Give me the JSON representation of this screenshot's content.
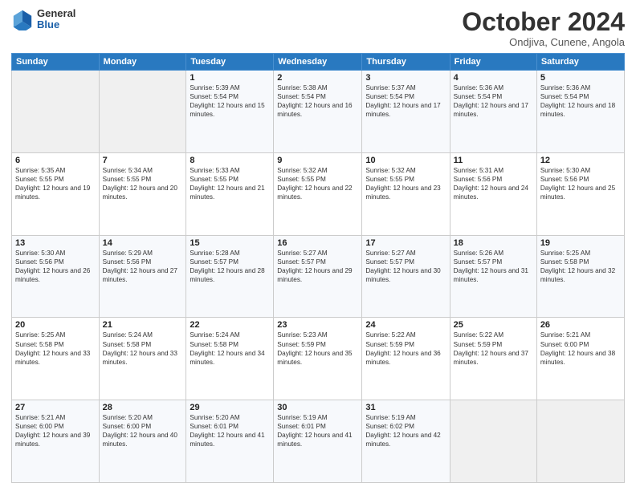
{
  "logo": {
    "general": "General",
    "blue": "Blue"
  },
  "title": "October 2024",
  "subtitle": "Ondjiva, Cunene, Angola",
  "headers": [
    "Sunday",
    "Monday",
    "Tuesday",
    "Wednesday",
    "Thursday",
    "Friday",
    "Saturday"
  ],
  "weeks": [
    [
      {
        "day": "",
        "empty": true
      },
      {
        "day": "",
        "empty": true
      },
      {
        "day": "1",
        "sunrise": "5:39 AM",
        "sunset": "5:54 PM",
        "daylight": "12 hours and 15 minutes."
      },
      {
        "day": "2",
        "sunrise": "5:38 AM",
        "sunset": "5:54 PM",
        "daylight": "12 hours and 16 minutes."
      },
      {
        "day": "3",
        "sunrise": "5:37 AM",
        "sunset": "5:54 PM",
        "daylight": "12 hours and 17 minutes."
      },
      {
        "day": "4",
        "sunrise": "5:36 AM",
        "sunset": "5:54 PM",
        "daylight": "12 hours and 17 minutes."
      },
      {
        "day": "5",
        "sunrise": "5:36 AM",
        "sunset": "5:54 PM",
        "daylight": "12 hours and 18 minutes."
      }
    ],
    [
      {
        "day": "6",
        "sunrise": "5:35 AM",
        "sunset": "5:55 PM",
        "daylight": "12 hours and 19 minutes."
      },
      {
        "day": "7",
        "sunrise": "5:34 AM",
        "sunset": "5:55 PM",
        "daylight": "12 hours and 20 minutes."
      },
      {
        "day": "8",
        "sunrise": "5:33 AM",
        "sunset": "5:55 PM",
        "daylight": "12 hours and 21 minutes."
      },
      {
        "day": "9",
        "sunrise": "5:32 AM",
        "sunset": "5:55 PM",
        "daylight": "12 hours and 22 minutes."
      },
      {
        "day": "10",
        "sunrise": "5:32 AM",
        "sunset": "5:55 PM",
        "daylight": "12 hours and 23 minutes."
      },
      {
        "day": "11",
        "sunrise": "5:31 AM",
        "sunset": "5:56 PM",
        "daylight": "12 hours and 24 minutes."
      },
      {
        "day": "12",
        "sunrise": "5:30 AM",
        "sunset": "5:56 PM",
        "daylight": "12 hours and 25 minutes."
      }
    ],
    [
      {
        "day": "13",
        "sunrise": "5:30 AM",
        "sunset": "5:56 PM",
        "daylight": "12 hours and 26 minutes."
      },
      {
        "day": "14",
        "sunrise": "5:29 AM",
        "sunset": "5:56 PM",
        "daylight": "12 hours and 27 minutes."
      },
      {
        "day": "15",
        "sunrise": "5:28 AM",
        "sunset": "5:57 PM",
        "daylight": "12 hours and 28 minutes."
      },
      {
        "day": "16",
        "sunrise": "5:27 AM",
        "sunset": "5:57 PM",
        "daylight": "12 hours and 29 minutes."
      },
      {
        "day": "17",
        "sunrise": "5:27 AM",
        "sunset": "5:57 PM",
        "daylight": "12 hours and 30 minutes."
      },
      {
        "day": "18",
        "sunrise": "5:26 AM",
        "sunset": "5:57 PM",
        "daylight": "12 hours and 31 minutes."
      },
      {
        "day": "19",
        "sunrise": "5:25 AM",
        "sunset": "5:58 PM",
        "daylight": "12 hours and 32 minutes."
      }
    ],
    [
      {
        "day": "20",
        "sunrise": "5:25 AM",
        "sunset": "5:58 PM",
        "daylight": "12 hours and 33 minutes."
      },
      {
        "day": "21",
        "sunrise": "5:24 AM",
        "sunset": "5:58 PM",
        "daylight": "12 hours and 33 minutes."
      },
      {
        "day": "22",
        "sunrise": "5:24 AM",
        "sunset": "5:58 PM",
        "daylight": "12 hours and 34 minutes."
      },
      {
        "day": "23",
        "sunrise": "5:23 AM",
        "sunset": "5:59 PM",
        "daylight": "12 hours and 35 minutes."
      },
      {
        "day": "24",
        "sunrise": "5:22 AM",
        "sunset": "5:59 PM",
        "daylight": "12 hours and 36 minutes."
      },
      {
        "day": "25",
        "sunrise": "5:22 AM",
        "sunset": "5:59 PM",
        "daylight": "12 hours and 37 minutes."
      },
      {
        "day": "26",
        "sunrise": "5:21 AM",
        "sunset": "6:00 PM",
        "daylight": "12 hours and 38 minutes."
      }
    ],
    [
      {
        "day": "27",
        "sunrise": "5:21 AM",
        "sunset": "6:00 PM",
        "daylight": "12 hours and 39 minutes."
      },
      {
        "day": "28",
        "sunrise": "5:20 AM",
        "sunset": "6:00 PM",
        "daylight": "12 hours and 40 minutes."
      },
      {
        "day": "29",
        "sunrise": "5:20 AM",
        "sunset": "6:01 PM",
        "daylight": "12 hours and 41 minutes."
      },
      {
        "day": "30",
        "sunrise": "5:19 AM",
        "sunset": "6:01 PM",
        "daylight": "12 hours and 41 minutes."
      },
      {
        "day": "31",
        "sunrise": "5:19 AM",
        "sunset": "6:02 PM",
        "daylight": "12 hours and 42 minutes."
      },
      {
        "day": "",
        "empty": true
      },
      {
        "day": "",
        "empty": true
      }
    ]
  ]
}
